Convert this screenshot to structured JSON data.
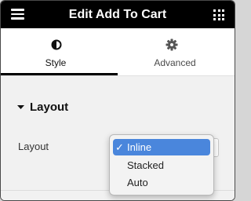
{
  "header": {
    "title": "Edit Add To Cart",
    "menu_icon": "hamburger-icon",
    "apps_icon": "grid-icon"
  },
  "tabs": [
    {
      "label": "Style",
      "icon": "half-circle-icon",
      "active": true
    },
    {
      "label": "Advanced",
      "icon": "gear-icon",
      "active": false
    }
  ],
  "section": {
    "title": "Layout",
    "toggle_icon": "caret-down-icon",
    "expanded": true
  },
  "layout_field": {
    "label": "Layout",
    "selected": "Inline",
    "options": [
      {
        "label": "Inline",
        "selected": true,
        "check": "✓"
      },
      {
        "label": "Stacked",
        "selected": false
      },
      {
        "label": "Auto",
        "selected": false
      }
    ]
  },
  "colors": {
    "header_bg": "#000000",
    "panel_bg": "#f1f1f1",
    "selection_blue": "#4a86dc"
  }
}
